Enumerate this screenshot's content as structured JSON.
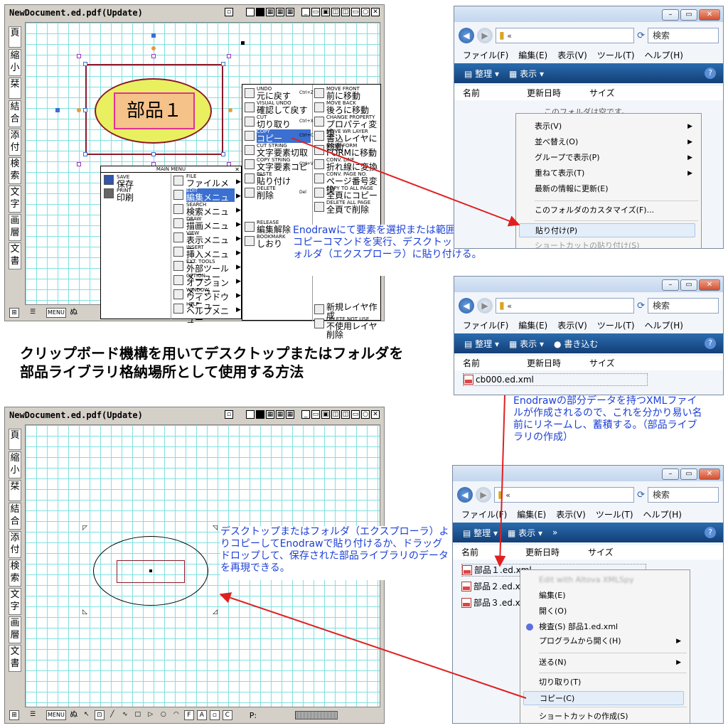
{
  "doc_window_top": {
    "title": "NewDocument.ed.pdf(Update)",
    "left_tools": [
      "頁",
      "縮小",
      "栞",
      "結合",
      "添付",
      "検索",
      "文字",
      "画層",
      "文書"
    ],
    "part_label": "部品１",
    "bottom_tools": [
      "MENU",
      "ぬ"
    ]
  },
  "main_menu": {
    "title": "MAIN MENU",
    "left_items": [
      {
        "en": "SAVE",
        "jp": "保存"
      },
      {
        "en": "PRINT",
        "jp": "印刷"
      }
    ],
    "mid_items": [
      {
        "en": "FILE",
        "jp": "ファイルメニュー"
      },
      {
        "en": "EDIT",
        "jp": "編集メニュー"
      },
      {
        "en": "SEARCH",
        "jp": "検索メニュー"
      },
      {
        "en": "DRAW",
        "jp": "描画メニュー"
      },
      {
        "en": "VIEW",
        "jp": "表示メニュー"
      },
      {
        "en": "INSERT",
        "jp": "挿入メニュー"
      },
      {
        "en": "EXT. TOOLS",
        "jp": "外部ツールメニュー"
      },
      {
        "en": "OPTION",
        "jp": "オプションメニュー"
      },
      {
        "en": "WINDOW",
        "jp": "ウィンドウメニュー"
      },
      {
        "en": "HELP",
        "jp": "ヘルプメニュー"
      }
    ]
  },
  "edit_menu": {
    "left_items": [
      {
        "en": "UNDO",
        "jp": "元に戻す"
      },
      {
        "en": "VISUAL UNDO",
        "jp": "確認して戻す"
      },
      {
        "en": "CUT",
        "jp": "切り取り"
      },
      {
        "en": "COPY",
        "jp": "コピー"
      },
      {
        "en": "CUT STRING",
        "jp": "文字要素切取"
      },
      {
        "en": "COPY STRING",
        "jp": "文字要素コピー"
      },
      {
        "en": "PASTE",
        "jp": "貼り付け"
      },
      {
        "en": "DELETE",
        "jp": "削除"
      },
      {
        "en": "RELEASE",
        "jp": "編集解除"
      },
      {
        "en": "BOOKMARK",
        "jp": "しおり"
      }
    ],
    "right_items": [
      {
        "en": "MOVE FRONT",
        "jp": "前に移動"
      },
      {
        "en": "MOVE BACK",
        "jp": "後ろに移動"
      },
      {
        "en": "CHANGE PROPERTY",
        "jp": "プロパティ変換"
      },
      {
        "en": "MOVE WR LAYER",
        "jp": "書込レイヤに移動"
      },
      {
        "en": "MOVE FORM",
        "jp": "FORMに移動"
      },
      {
        "en": "CONV. LINE",
        "jp": "折れ線に変換"
      },
      {
        "en": "CONV. PAGE NO.",
        "jp": "ページ番号変換"
      },
      {
        "en": "COPY TO ALL PAGE",
        "jp": "全頁にコピー"
      },
      {
        "en": "DELETE ALL PAGE",
        "jp": "全頁で削除"
      },
      {
        "en": "",
        "jp": "新規レイヤ作成"
      },
      {
        "en": "DELETE NOT USE",
        "jp": "不使用レイヤ削除"
      }
    ],
    "shortcuts": [
      "Ctrl+Z",
      "Ctrl+X",
      "Ctrl+C",
      "Ctrl+V",
      "Del"
    ]
  },
  "notes": {
    "note1": "Enodrawにて要素を選択または範囲選択してコピーコマンドを実行、デスクトップまたはフォルダ（エクスプローラ）に貼り付ける。",
    "note2": "Enodrawの部分データを持つXMLファイルが作成されるので、これを分かり易い名前にリネームし、蓄積する。（部品ライブラリの作成）",
    "note3": "デスクトップまたはフォルダ（エクスプローラ）よりコピーしてEnodrawで貼り付けるか、ドラッグドロップして、保存された部品ライブラリのデータを再現できる。"
  },
  "heading": {
    "line1": "クリップボード機構を用いてデスクトップまたはフォルダを",
    "line2": "部品ライブラリ格納場所として使用する方法"
  },
  "doc_window_bottom": {
    "title": "NewDocument.ed.pdf(Update)",
    "left_tools": [
      "頁",
      "縮小",
      "栞",
      "結合",
      "添付",
      "検索",
      "文字",
      "画層",
      "文書"
    ],
    "status_label": "P:",
    "bottom_tools": [
      "MENU",
      "ぬ"
    ]
  },
  "explorer": {
    "search": "検索",
    "addr_prefix": "«",
    "menu": [
      "ファイル(F)",
      "編集(E)",
      "表示(V)",
      "ツール(T)",
      "ヘルプ(H)"
    ],
    "organize": "整理",
    "view": "表示",
    "write": "書き込む",
    "more": "»",
    "col_name": "名前",
    "col_date": "更新日時",
    "col_size": "サイズ",
    "empty_text": "このフォルダは空です。",
    "ctx1": [
      {
        "label": "表示(V)",
        "sub": true
      },
      {
        "label": "並べ替え(O)",
        "sub": true
      },
      {
        "label": "グループで表示(P)",
        "sub": true
      },
      {
        "label": "重ねて表示(T)",
        "sub": true
      },
      {
        "label": "最新の情報に更新(E)",
        "sub": false
      },
      {
        "label": "このフォルダのカスタマイズ(F)...",
        "sub": false
      },
      {
        "label": "貼り付け(P)",
        "sub": false
      },
      {
        "label": "ショートカットの貼り付け(S)",
        "sub": false
      }
    ],
    "file1": "cb000.ed.xml",
    "files3": [
      "部品１.ed.xml",
      "部品２.ed.x",
      "部品３.ed.x"
    ],
    "ctx3": [
      {
        "label": "Edit with Altova XMLSpy",
        "sub": false
      },
      {
        "label": "編集(E)",
        "sub": false
      },
      {
        "label": "開く(O)",
        "sub": false
      },
      {
        "label": "検査(S) 部品1.ed.xml",
        "sub": false
      },
      {
        "label": "プログラムから開く(H)",
        "sub": true
      },
      {
        "label": "送る(N)",
        "sub": true
      },
      {
        "label": "切り取り(T)",
        "sub": false
      },
      {
        "label": "コピー(C)",
        "sub": false
      },
      {
        "label": "ショートカットの作成(S)",
        "sub": false
      }
    ]
  },
  "colors": {
    "note_blue": "#1b3fd6",
    "arrow_red": "#e02020",
    "grid": "#7fe0e0",
    "part_rect": "#8b1a2a",
    "ellipse_fill": "#e8f060",
    "label_fill": "#f5c28a",
    "label_border": "#e0309a"
  }
}
